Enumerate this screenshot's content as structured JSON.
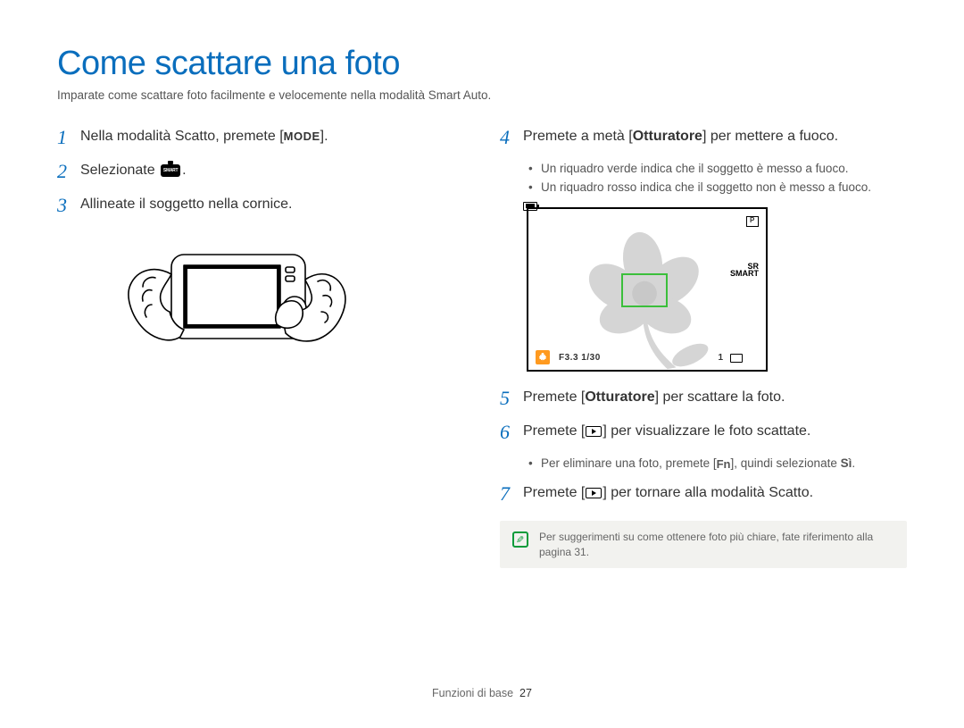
{
  "title": "Come scattare una foto",
  "subtitle": "Imparate come scattare foto facilmente e velocemente nella modalità Smart Auto.",
  "left": {
    "step1_a": "Nella modalità Scatto, premete [",
    "step1_mode": "MODE",
    "step1_b": "].",
    "step2_a": "Selezionate ",
    "step2_b": ".",
    "step3": "Allineate il soggetto nella cornice.",
    "smart_label": "SMART"
  },
  "right": {
    "step4_a": "Premete a metà [",
    "step4_bold": "Otturatore",
    "step4_b": "] per mettere a fuoco.",
    "step4_sub1": "Un riquadro verde indica che il soggetto è messo a fuoco.",
    "step4_sub2": "Un riquadro rosso indica che il soggetto non è messo a fuoco.",
    "lcd": {
      "exposure": "F3.3  1/30",
      "count": "1",
      "sr_label": "SR\nSMART"
    },
    "step5_a": "Premete [",
    "step5_bold": "Otturatore",
    "step5_b": "] per scattare la foto.",
    "step6_a": "Premete [",
    "step6_b": "] per visualizzare le foto scattate.",
    "step6_sub_a": "Per eliminare una foto, premete [",
    "step6_sub_fn": "Fn",
    "step6_sub_b": "], quindi selezionate ",
    "step6_sub_bold": "Sì",
    "step6_sub_c": ".",
    "step7_a": "Premete [",
    "step7_b": "] per tornare alla modalità Scatto.",
    "note": "Per suggerimenti su come ottenere foto più chiare, fate riferimento alla pagina 31."
  },
  "footer": {
    "section": "Funzioni di base",
    "page": "27"
  }
}
